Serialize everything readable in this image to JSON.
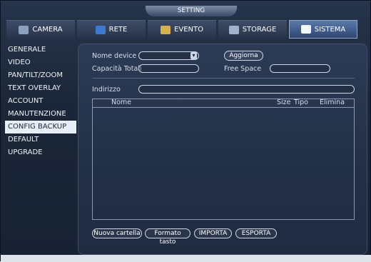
{
  "window": {
    "title": "SETTING"
  },
  "tabs": [
    {
      "label": "CAMERA",
      "icon": "camera-icon",
      "active": false
    },
    {
      "label": "RETE",
      "icon": "network-icon",
      "active": false
    },
    {
      "label": "EVENTO",
      "icon": "event-icon",
      "active": false
    },
    {
      "label": "STORAGE",
      "icon": "storage-icon",
      "active": false
    },
    {
      "label": "SISTEMA",
      "icon": "system-icon",
      "active": true
    }
  ],
  "sidebar": {
    "items": [
      {
        "label": "GENERALE"
      },
      {
        "label": "VIDEO"
      },
      {
        "label": "PAN/TILT/ZOOM"
      },
      {
        "label": "TEXT OVERLAY"
      },
      {
        "label": "ACCOUNT"
      },
      {
        "label": "MANUTENZIONE"
      },
      {
        "label": "CONFIG BACKUP",
        "active": true
      },
      {
        "label": "DEFAULT"
      },
      {
        "label": "UPGRADE"
      }
    ]
  },
  "form": {
    "device_label": "Nome device",
    "device_value": "",
    "refresh_label": "Aggiorna",
    "capacity_label": "Capacità Totali",
    "capacity_value": "",
    "free_space_label": "Free Space",
    "free_space_value": "",
    "address_label": "Indirizzo",
    "address_value": ""
  },
  "table": {
    "columns": [
      "Nome",
      "Size",
      "Tipo",
      "Elimina"
    ],
    "rows": []
  },
  "actions": {
    "new_folder": "Nuova cartella",
    "format": "Formato tasto",
    "import": "IMPORTA",
    "export": "ESPORTA"
  },
  "colors": {
    "active_tab": "#4e6fa3",
    "panel": "#2a3852"
  }
}
